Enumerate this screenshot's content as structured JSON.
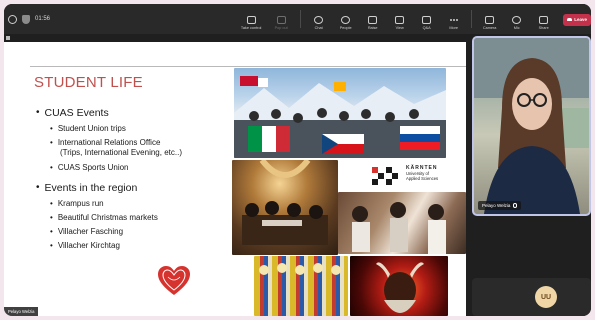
{
  "toolbar": {
    "timer": "01:56",
    "buttons": [
      {
        "label": "Take control",
        "icon": "take-control-icon",
        "enabled": true
      },
      {
        "label": "Pop out",
        "icon": "pop-out-icon",
        "enabled": false
      },
      {
        "label": "Chat",
        "icon": "chat-icon",
        "enabled": true
      },
      {
        "label": "People",
        "icon": "people-icon",
        "enabled": true
      },
      {
        "label": "Raise",
        "icon": "raise-hand-icon",
        "enabled": true
      },
      {
        "label": "View",
        "icon": "view-icon",
        "enabled": true
      },
      {
        "label": "Q&A",
        "icon": "qa-icon",
        "enabled": true
      },
      {
        "label": "More",
        "icon": "more-icon",
        "enabled": true
      },
      {
        "label": "Camera",
        "icon": "camera-icon",
        "enabled": true
      },
      {
        "label": "Mic",
        "icon": "mic-icon",
        "enabled": true
      },
      {
        "label": "Share",
        "icon": "share-icon",
        "enabled": true
      }
    ],
    "leave_label": "Leave",
    "leave_color": "#c4314b"
  },
  "slide": {
    "title": "STUDENT LIFE",
    "title_color": "#c0504d",
    "sections": [
      {
        "heading": "CUAS Events",
        "items": [
          [
            "Student Union trips"
          ],
          [
            "International Relations Office",
            "(Trips, International Evening, etc..)"
          ],
          [
            "CUAS Sports Union"
          ]
        ]
      },
      {
        "heading": "Events in the region",
        "items": [
          [
            "Krampus run"
          ],
          [
            "Beautiful Christmas markets"
          ],
          [
            "Villacher Fasching"
          ],
          [
            "Villacher Kirchtag"
          ]
        ]
      }
    ],
    "logo": {
      "line1": "KÄRNTEN",
      "line2": "University of",
      "line3": "Applied Sciences"
    }
  },
  "participants": {
    "presenter_name": "Pelayo Welzia",
    "avatar_initials": "UU",
    "avatar_color": "#f0d5a6",
    "sharer_label": "Pelayo Welzia"
  }
}
